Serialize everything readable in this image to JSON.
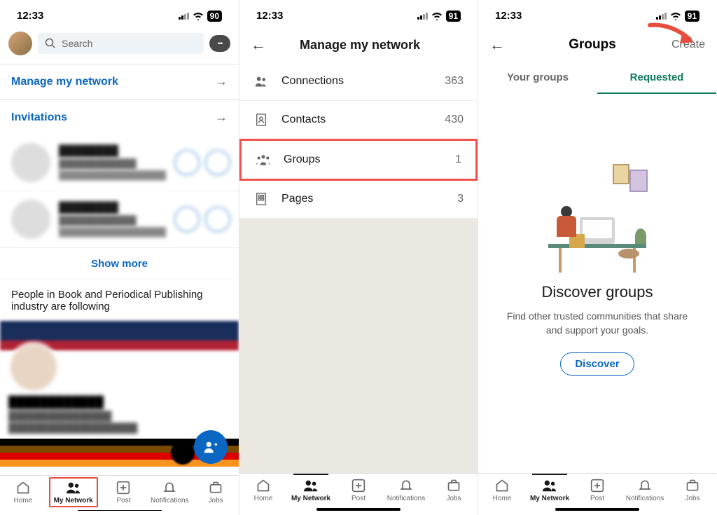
{
  "status": {
    "time": "12:33",
    "battery_1": "90",
    "battery_2": "91",
    "battery_3": "91"
  },
  "phone1": {
    "search_placeholder": "Search",
    "manage_link": "Manage my network",
    "invitations_label": "Invitations",
    "show_more": "Show more",
    "suggestion_heading": "People in Book and Periodical Publishing industry are following"
  },
  "phone2": {
    "title": "Manage my network",
    "rows": [
      {
        "label": "Connections",
        "count": "363"
      },
      {
        "label": "Contacts",
        "count": "430"
      },
      {
        "label": "Groups",
        "count": "1"
      },
      {
        "label": "Pages",
        "count": "3"
      }
    ]
  },
  "phone3": {
    "title": "Groups",
    "create": "Create",
    "tab_your": "Your groups",
    "tab_requested": "Requested",
    "empty_heading": "Discover groups",
    "empty_body": "Find other trusted communities that share and support your goals.",
    "discover_btn": "Discover"
  },
  "tabs": {
    "home": "Home",
    "network": "My Network",
    "post": "Post",
    "notifications": "Notifications",
    "jobs": "Jobs"
  }
}
